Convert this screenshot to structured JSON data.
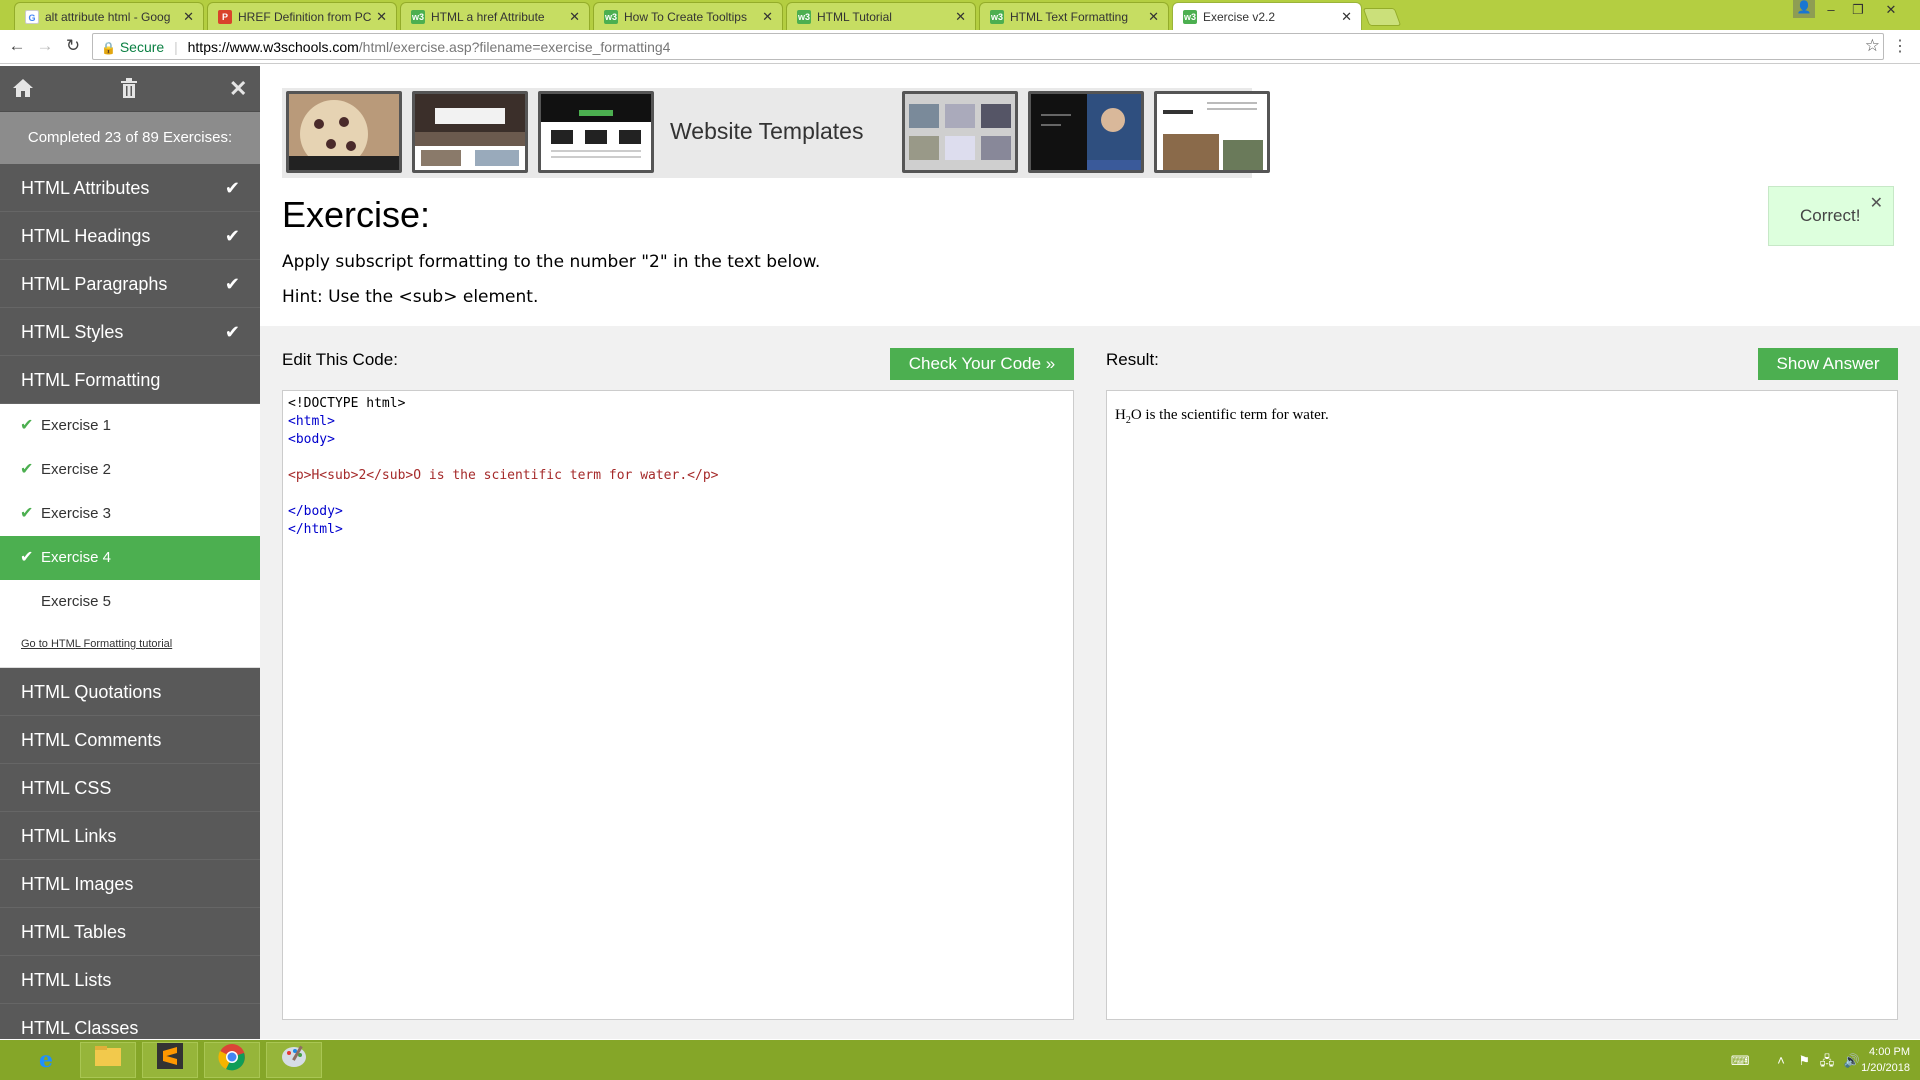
{
  "browser": {
    "tabs": [
      {
        "title": "alt attribute html - Goog",
        "icon": "google-icon",
        "color": "#4285f4"
      },
      {
        "title": "HREF Definition from PC",
        "icon": "pc-icon",
        "color": "#d9432b"
      },
      {
        "title": "HTML a href Attribute",
        "icon": "w3-icon",
        "color": "#4caf50"
      },
      {
        "title": "How To Create Tooltips",
        "icon": "w3-icon",
        "color": "#4caf50"
      },
      {
        "title": "HTML Tutorial",
        "icon": "w3-icon",
        "color": "#4caf50"
      },
      {
        "title": "HTML Text Formatting",
        "icon": "w3-icon",
        "color": "#4caf50"
      },
      {
        "title": "Exercise v2.2",
        "icon": "w3-icon",
        "color": "#4caf50",
        "active": true
      }
    ],
    "address": {
      "secure_label": "Secure",
      "url_host": "https://www.w3schools.com",
      "url_path": "/html/exercise.asp?filename=exercise_formatting4"
    }
  },
  "sidebar": {
    "progress": "Completed 23 of 89 Exercises:",
    "categories_before": [
      {
        "label": "HTML Attributes",
        "done": true
      },
      {
        "label": "HTML Headings",
        "done": true
      },
      {
        "label": "HTML Paragraphs",
        "done": true
      },
      {
        "label": "HTML Styles",
        "done": true
      }
    ],
    "current_category": "HTML Formatting",
    "exercises": [
      {
        "label": "Exercise 1",
        "done": true
      },
      {
        "label": "Exercise 2",
        "done": true
      },
      {
        "label": "Exercise 3",
        "done": true
      },
      {
        "label": "Exercise 4",
        "done": true,
        "current": true
      },
      {
        "label": "Exercise 5",
        "done": false
      }
    ],
    "tutorial_link": "Go to HTML Formatting tutorial",
    "categories_after": [
      {
        "label": "HTML Quotations"
      },
      {
        "label": "HTML Comments"
      },
      {
        "label": "HTML CSS"
      },
      {
        "label": "HTML Links"
      },
      {
        "label": "HTML Images"
      },
      {
        "label": "HTML Tables"
      },
      {
        "label": "HTML Lists"
      },
      {
        "label": "HTML Classes"
      }
    ]
  },
  "main": {
    "banner_text": "Website Templates",
    "exercise_title": "Exercise:",
    "instruction": "Apply subscript formatting to the number \"2\" in the text below.",
    "hint": "Hint: Use the <sub> element.",
    "feedback": "Correct!",
    "edit_label": "Edit This Code:",
    "check_button": "Check Your Code »",
    "result_label": "Result:",
    "show_answer_button": "Show Answer",
    "code_lines": [
      "<!DOCTYPE html>",
      "<html>",
      "<body>",
      "",
      "<p>H<sub>2</sub>O is the scientific term for water.</p>",
      "",
      "</body>",
      "</html>"
    ],
    "result": {
      "before": "H",
      "sub": "2",
      "after": "O is the scientific term for water."
    }
  },
  "taskbar": {
    "time": "4:00 PM",
    "date": "1/20/2018"
  },
  "colors": {
    "accent_green": "#4caf50",
    "sidebar_bg": "#595959",
    "taskbar": "#85a628"
  }
}
